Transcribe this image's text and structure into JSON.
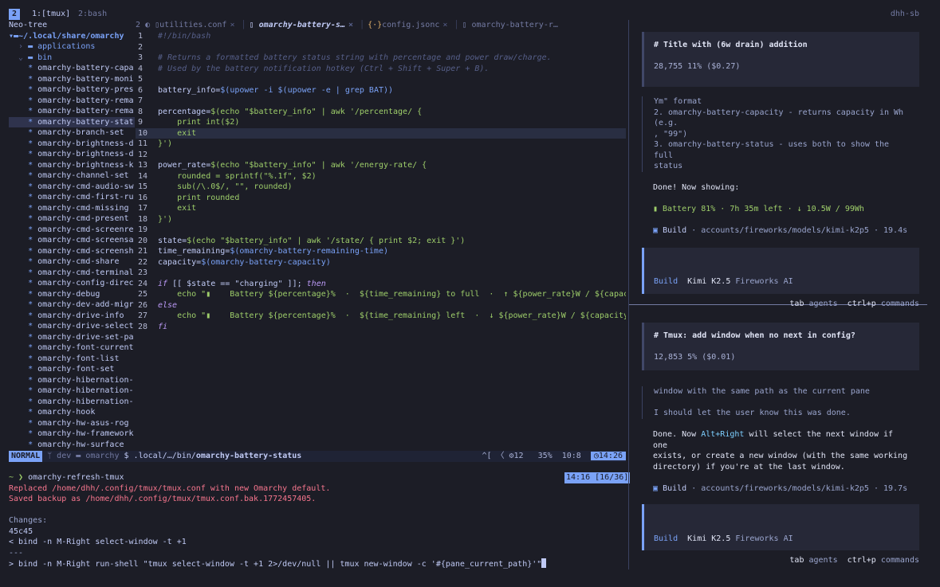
{
  "tmux": {
    "window_number": "2",
    "window_1": "1:[tmux]",
    "window_2": "2:bash",
    "host": "dhh-sb"
  },
  "tree": {
    "header": "Neo-tree",
    "root": "~/.local/share/omarchy",
    "dirs": [
      "applications",
      "bin"
    ],
    "files": [
      "omarchy-battery-capa",
      "omarchy-battery-moni",
      "omarchy-battery-pres",
      "omarchy-battery-rema",
      "omarchy-battery-rema",
      "omarchy-battery-stat",
      "omarchy-branch-set",
      "omarchy-brightness-d",
      "omarchy-brightness-d",
      "omarchy-brightness-k",
      "omarchy-channel-set",
      "omarchy-cmd-audio-sw",
      "omarchy-cmd-first-ru",
      "omarchy-cmd-missing",
      "omarchy-cmd-present",
      "omarchy-cmd-screenre",
      "omarchy-cmd-screensa",
      "omarchy-cmd-screensh",
      "omarchy-cmd-share",
      "omarchy-cmd-terminal",
      "omarchy-config-direc",
      "omarchy-debug",
      "omarchy-dev-add-migr",
      "omarchy-drive-info",
      "omarchy-drive-select",
      "omarchy-drive-set-pa",
      "omarchy-font-current",
      "omarchy-font-list",
      "omarchy-font-set",
      "omarchy-hibernation-",
      "omarchy-hibernation-",
      "omarchy-hibernation-",
      "omarchy-hook",
      "omarchy-hw-asus-rog",
      "omarchy-hw-framework",
      "omarchy-hw-surface"
    ]
  },
  "tabs": [
    {
      "prefix": "2",
      "label": "utilities.conf"
    },
    {
      "prefix": "",
      "label": "omarchy-battery-s…"
    },
    {
      "prefix": "",
      "label": "config.jsonc"
    },
    {
      "prefix": "",
      "label": "omarchy-battery-r…"
    }
  ],
  "code": {
    "line_numbers": [
      "1",
      "2",
      "3",
      "4",
      "5",
      "6",
      "7",
      "8",
      "9",
      "10",
      "11",
      "12",
      "13",
      "14",
      "15",
      "16",
      "17",
      "18",
      "19",
      "20",
      "21",
      "22",
      "23",
      "24",
      "25",
      "26",
      "27",
      "28"
    ],
    "l1": "#!/bin/bash",
    "l3": "# Returns a formatted battery status string with percentage and power draw/charge.",
    "l4": "# Used by the battery notification hotkey (Ctrl + Shift + Super + B).",
    "l6a": "battery_info=",
    "l6b": "$(upower -i $(upower -e | grep BAT))",
    "l8a": "percentage=",
    "l8b": "$(echo \"$battery_info\" | awk '/percentage/ {",
    "l9": "    print int($2)",
    "l10": "    exit",
    "l11": "}')",
    "l13a": "power_rate=",
    "l13b": "$(echo \"$battery_info\" | awk '/energy-rate/ {",
    "l14": "    rounded = sprintf(\"%.1f\", $2)",
    "l15": "    sub(/\\.0$/, \"\", rounded)",
    "l16": "    print rounded",
    "l17": "    exit",
    "l18": "}')",
    "l20a": "state=",
    "l20b": "$(echo \"$battery_info\" | awk '/state/ { print $2; exit }')",
    "l21a": "time_remaining=",
    "l21b": "$(omarchy-battery-remaining-time)",
    "l22a": "capacity=",
    "l22b": "$(omarchy-battery-capacity)",
    "l24a": "if",
    "l24b": " [[ $state == \"charging\" ]]; ",
    "l24c": "then",
    "l25": "    echo \"▮    Battery ${percentage}%  ·  ${time_remaining} to full  ·  ↑ ${power_rate}W / ${capacit",
    "l26": "else",
    "l27": "    echo \"▮    Battery ${percentage}%  ·  ${time_remaining} left  ·  ↓ ${power_rate}W / ${capacity}W",
    "l28": "fi"
  },
  "nvim_status": {
    "mode": "NORMAL",
    "branch": " dev",
    "folder": "  omarchy",
    "shell_marker": "$",
    "path_prefix": "  .local/…/bin/",
    "path_file": "omarchy-battery-status",
    "right": "^[ 〈 ⚙12   35%  10:8  ",
    "clock": "◷14:26"
  },
  "terminal": {
    "prompt": "~ ❯ ",
    "command": "omarchy-refresh-tmux",
    "clock": "14:16 [16/36]",
    "replaced": "Replaced /home/dhh/.config/tmux/tmux.conf with new Omarchy default.",
    "saved": "Saved backup as /home/dhh/.config/tmux/tmux.conf.bak.1772457405.",
    "changes": "Changes:",
    "diffhead": "45c45",
    "old": "< bind -n M-Right select-window -t +1",
    "sep": "---",
    "new": "> bind -n M-Right run-shell \"tmux select-window -t +1 2>/dev/null || tmux new-window -c '#{pane_current_path}'\""
  },
  "agent1": {
    "title": "# Title with (6w drain) addition",
    "meta": "28,755  11% ($0.27)",
    "r1": "Ym\" format",
    "r2": "2. omarchy-battery-capacity - returns capacity in Wh (e.g.",
    "r3": ", \"99\")",
    "r4": "3. omarchy-battery-status - uses both to show the full",
    "r5": "status",
    "done": "Done! Now showing:",
    "battery": "▮    Battery 81%  ·  7h 35m left  ·  ↓ 10.5W  /  99Wh",
    "build_label": "Build",
    "build_path": " · accounts/fireworks/models/kimi-k2p5 · 19.4s",
    "in_label": "Build",
    "in_model": "Kimi K2.5",
    "in_provider": "Fireworks AI",
    "hint1_key": "tab",
    "hint1": "agents",
    "hint2_key": "ctrl+p",
    "hint2": "commands"
  },
  "agent2": {
    "title": "# Tmux: add window when no next in config?",
    "meta": "12,853  5% ($0.01)",
    "r1": "window with the same path as the current pane",
    "r2": "I should let the user know this was done.",
    "done_a": "Done. Now ",
    "done_hl": "Alt+Right",
    "done_b": " will select the next window if one",
    "d2": "exists, or create a new window (with the same working",
    "d3": "directory) if you're at the last window.",
    "build_label": "Build",
    "build_path": " · accounts/fireworks/models/kimi-k2p5 · 19.7s",
    "in_label": "Build",
    "in_model": "Kimi K2.5",
    "in_provider": "Fireworks AI",
    "hint1_key": "tab",
    "hint1": "agents",
    "hint2_key": "ctrl+p",
    "hint2": "commands"
  }
}
